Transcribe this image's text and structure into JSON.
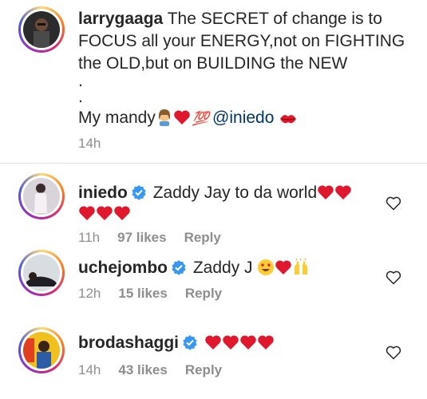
{
  "post": {
    "username": "larrygaaga",
    "line1": "The SECRET of change is to",
    "line2": "FOCUS all your ENERGY,not on FIGHTING",
    "line3": "the OLD,but on BUILDING the NEW",
    "dot1": ".",
    "dot2": ".",
    "line4_prefix": "My mandy",
    "hundred_emoji": "💯",
    "mention": "@iniedo",
    "time": "14h"
  },
  "comments": [
    {
      "username": "iniedo",
      "verified": true,
      "text": "Zaddy Jay to da world",
      "time": "11h",
      "likes": "97 likes",
      "reply": "Reply"
    },
    {
      "username": "uchejombo",
      "verified": true,
      "text": "Zaddy J",
      "time": "12h",
      "likes": "15 likes",
      "reply": "Reply"
    },
    {
      "username": "brodashaggi",
      "verified": true,
      "text": "",
      "time": "14h",
      "likes": "43 likes",
      "reply": "Reply"
    }
  ],
  "colors": {
    "heart": "#e0182d",
    "verified": "#3897f0",
    "meta": "#8e8e8e",
    "mention": "#003569"
  },
  "icons": [
    "heart-icon",
    "verified-badge-icon",
    "like-heart-outline-icon",
    "kiss-mark-icon",
    "woman-emoji-icon",
    "smiling-heart-eyes-icon",
    "raised-hands-icon"
  ]
}
